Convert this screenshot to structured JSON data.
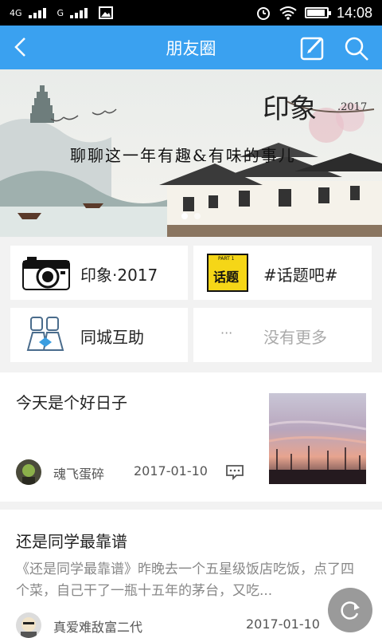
{
  "status_bar": {
    "signal_1": "4G",
    "signal_2": "G",
    "time": "14:08",
    "battery_level": 0.9
  },
  "header": {
    "title": "朋友圈",
    "icons": [
      "back-arrow-icon",
      "edit-icon",
      "search-icon"
    ]
  },
  "banner": {
    "title": "印象",
    "year": ".2017",
    "subtitle": "聊聊这一年有趣&有味的事儿",
    "active_slide": 1,
    "slide_count": 2
  },
  "quick_links": [
    {
      "label": "印象·2017",
      "icon": "camera-icon"
    },
    {
      "label": "#话题吧#",
      "icon": "topic-icon",
      "icon_text": "话题",
      "icon_small": "PART 1"
    },
    {
      "label": "同城互助",
      "icon": "people-icon"
    },
    {
      "label": "没有更多",
      "icon": "more-dots-icon",
      "icon_text": "···"
    }
  ],
  "posts": [
    {
      "title": "今天是个好日子",
      "author": "魂飞蛋碎",
      "date": "2017-01-10"
    },
    {
      "title": "还是同学最靠谱",
      "excerpt": "《还是同学最靠谱》昨晚去一个五星级饭店吃饭，点了四个菜，自己干了一瓶十五年的茅台，又吃...",
      "author": "真爱难敌富二代",
      "date": "2017-01-10"
    }
  ],
  "colors": {
    "header_bg": "#3aa1f0",
    "text_primary": "#222222",
    "text_secondary": "#888888"
  }
}
